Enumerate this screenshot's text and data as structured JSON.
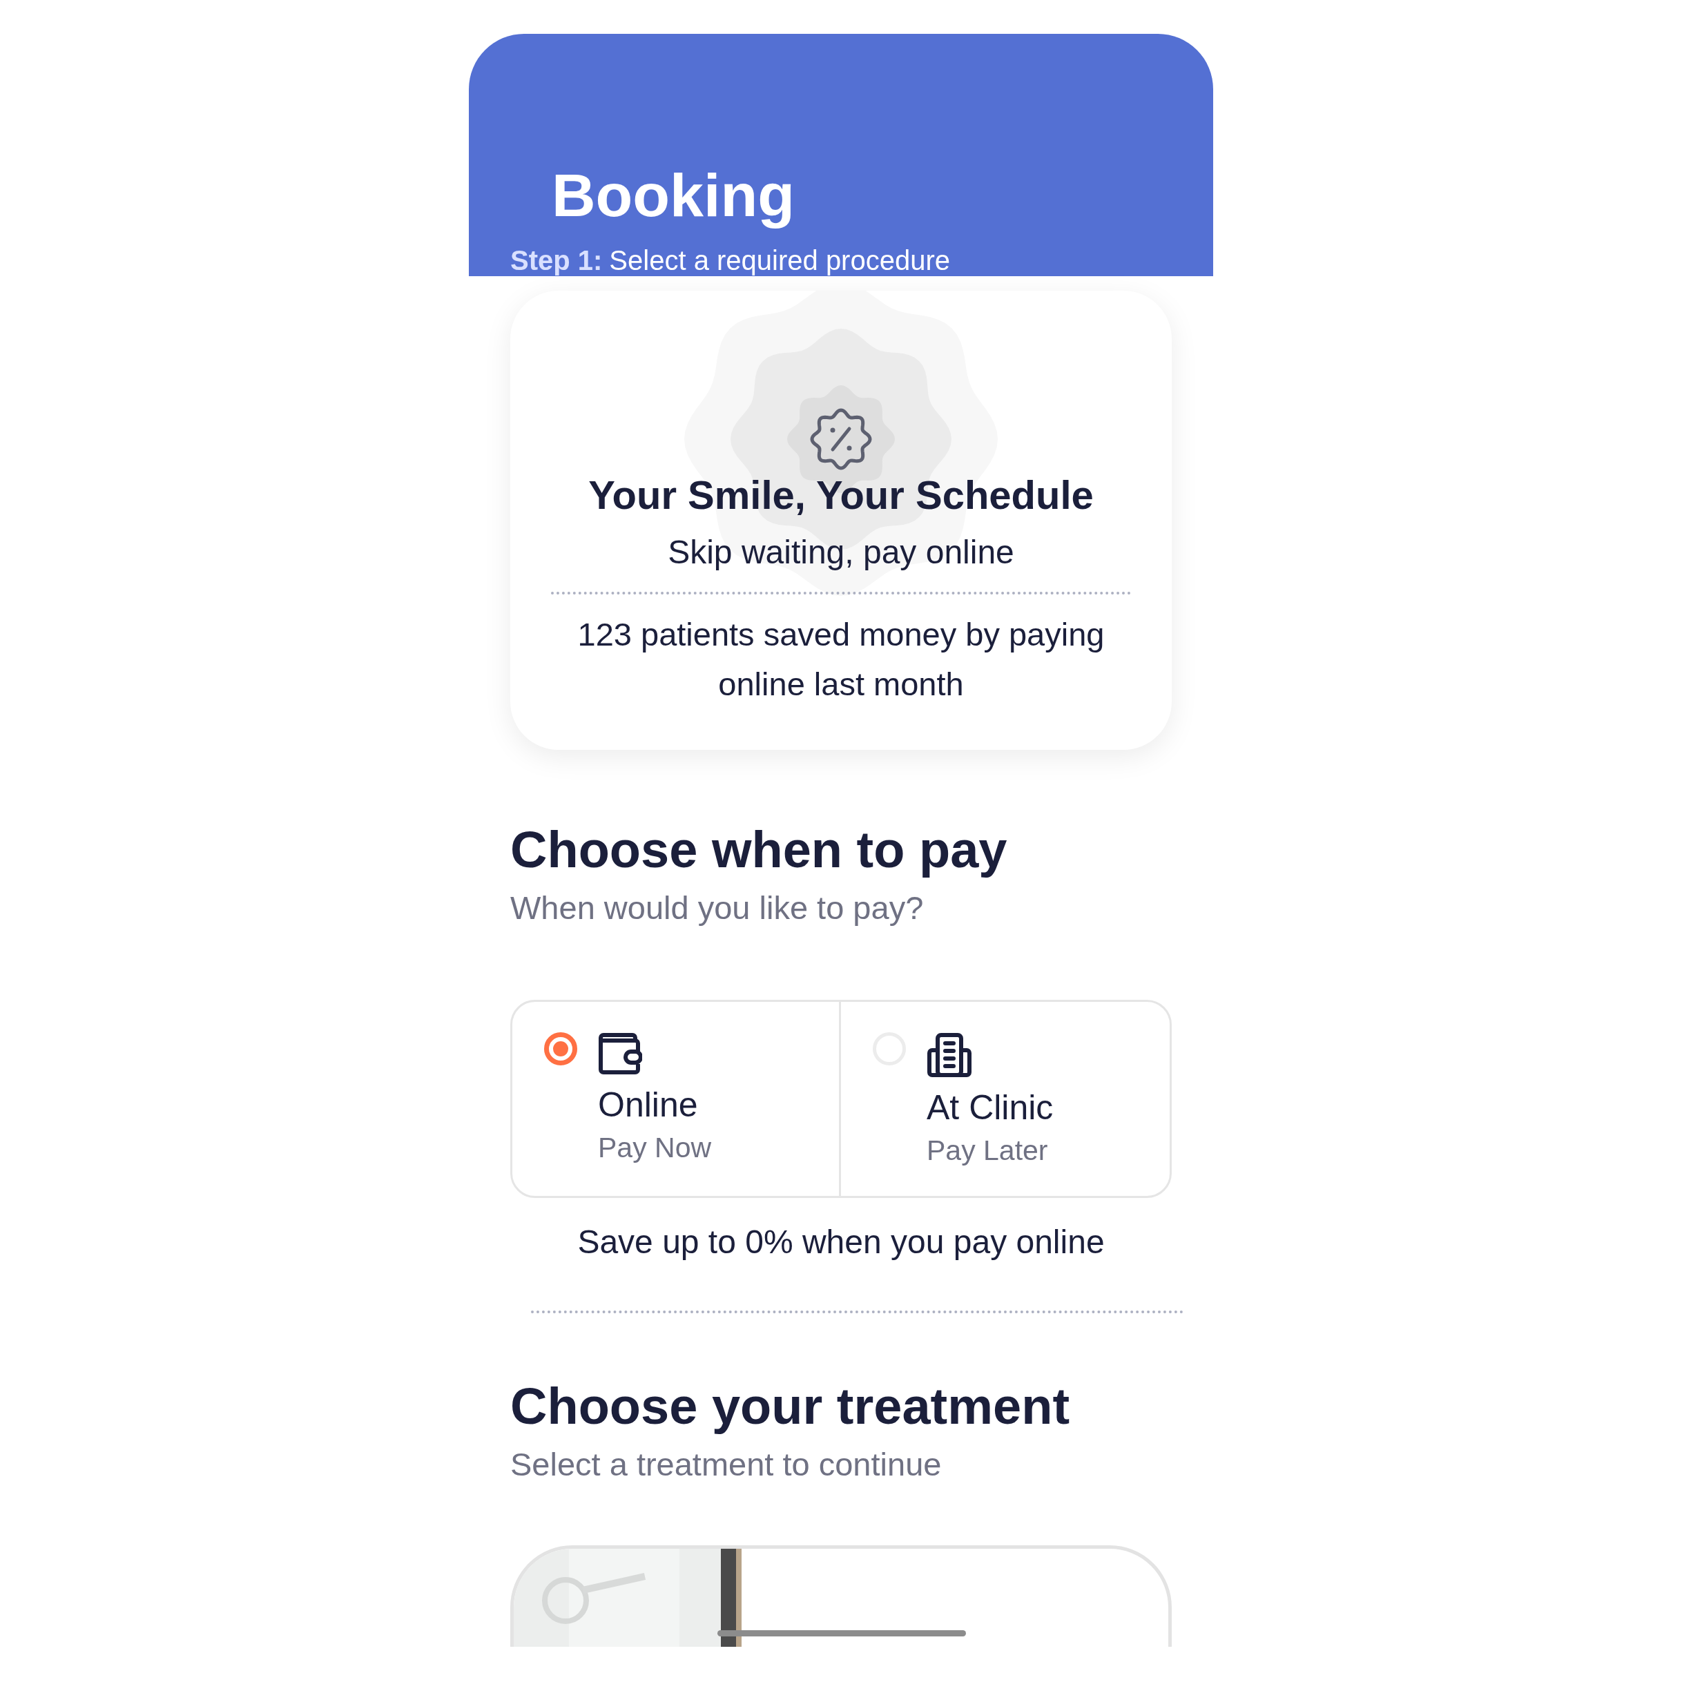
{
  "header": {
    "title": "Booking",
    "step_label": "Step 1:",
    "step_text": "Select a required procedure"
  },
  "promo": {
    "title": "Your Smile, Your Schedule",
    "subtitle": "Skip waiting, pay online",
    "stat": "123 patients saved money by paying online last month"
  },
  "payment": {
    "heading": "Choose when to pay",
    "subheading": "When would you like to pay?",
    "options": [
      {
        "kind": "wallet",
        "title": "Online",
        "subtitle": "Pay Now",
        "selected": true
      },
      {
        "kind": "building",
        "title": "At Clinic",
        "subtitle": "Pay Later",
        "selected": false
      }
    ],
    "note": "Save up to 0% when you pay online"
  },
  "treatment": {
    "heading": "Choose your treatment",
    "subheading": "Select a treatment to continue"
  }
}
